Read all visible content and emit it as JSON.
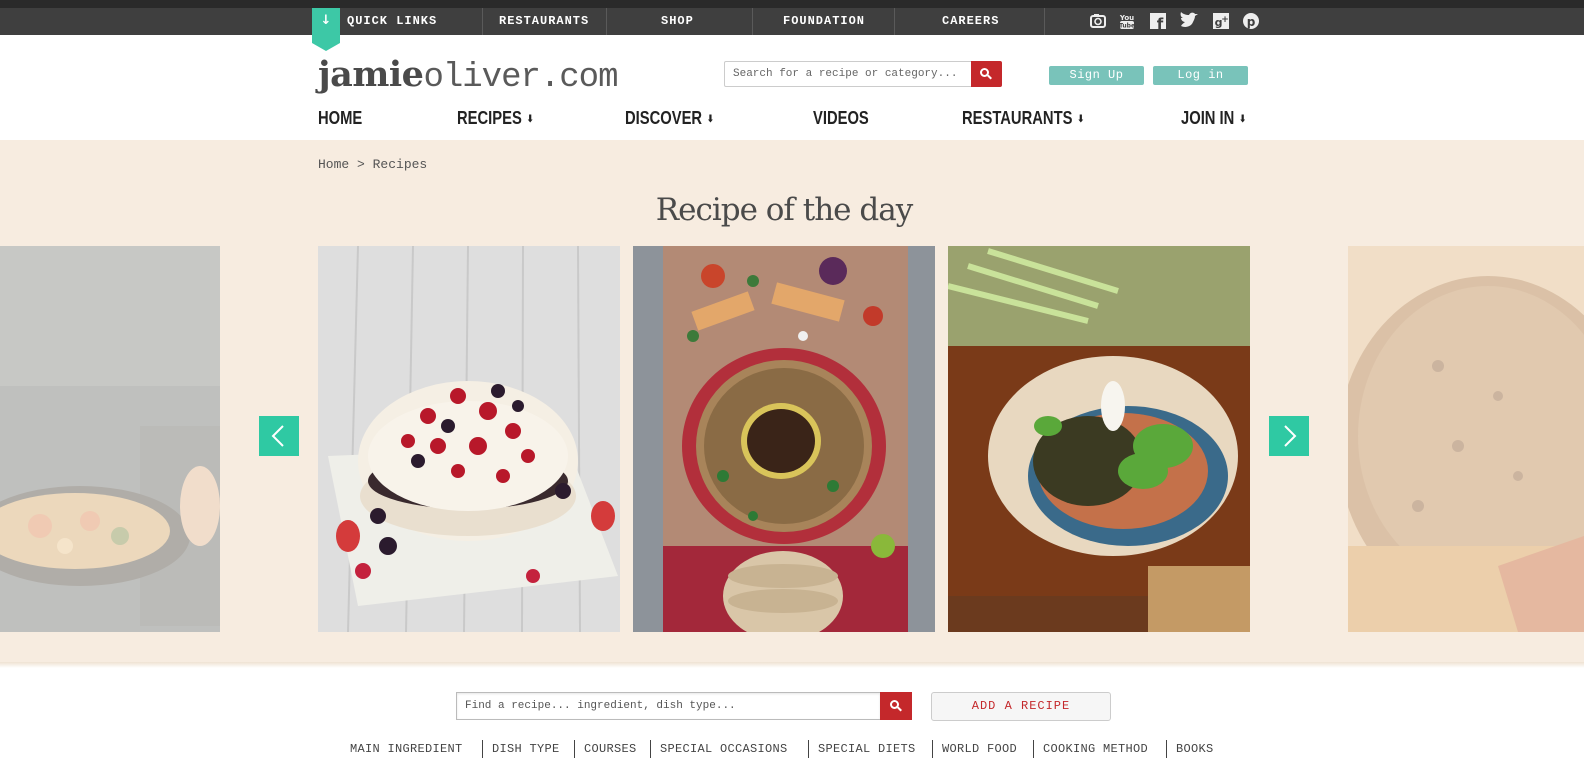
{
  "topbar": {
    "quick_links": "QUICK LINKS",
    "links": [
      "RESTAURANTS",
      "SHOP",
      "FOUNDATION",
      "CAREERS"
    ],
    "social": [
      "instagram-icon",
      "youtube-icon",
      "facebook-icon",
      "twitter-icon",
      "google-plus-icon",
      "pinterest-icon"
    ]
  },
  "header": {
    "logo_bold": "jamie",
    "logo_rest": "oliver.com",
    "search_placeholder": "Search for a recipe or category...",
    "signup": "Sign Up",
    "login": "Log in"
  },
  "nav": [
    "HOME",
    "RECIPES",
    "DISCOVER",
    "VIDEOS",
    "RESTAURANTS",
    "JOIN IN"
  ],
  "breadcrumb": "Home > Recipes",
  "carousel": {
    "title": "Recipe of the day"
  },
  "finder": {
    "placeholder": "Find a recipe... ingredient, dish type...",
    "add_recipe": "ADD A RECIPE",
    "categories": [
      "MAIN INGREDIENT",
      "DISH TYPE",
      "COURSES",
      "SPECIAL OCCASIONS",
      "SPECIAL DIETS",
      "WORLD FOOD",
      "COOKING METHOD",
      "BOOKS"
    ]
  },
  "colors": {
    "accent": "#2fc9a3",
    "brand_red": "#c4282b",
    "cream": "#f7ece0",
    "topbar": "#3f3f3f"
  }
}
